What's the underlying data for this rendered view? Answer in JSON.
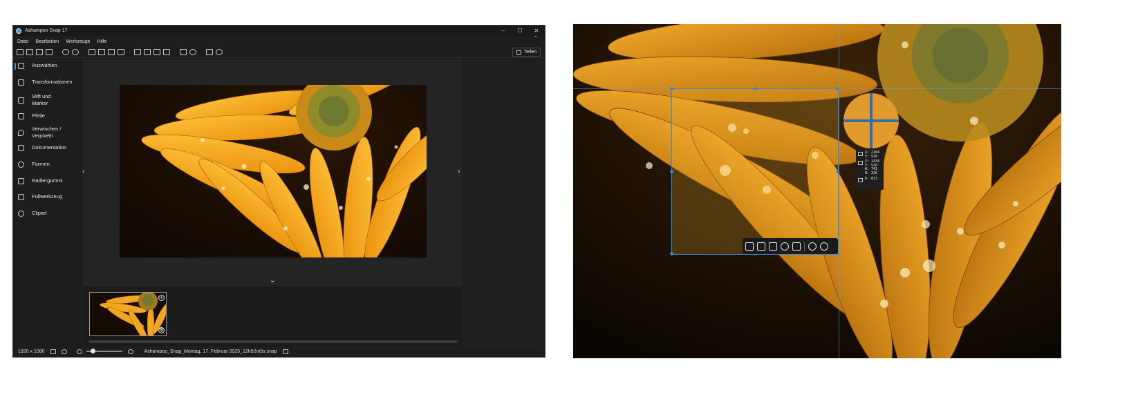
{
  "app": {
    "title": "Ashampoo Snap 17",
    "window_controls": [
      "–",
      "☐",
      "✕"
    ],
    "collapse_caret": "⌃"
  },
  "menu": [
    "Datei",
    "Bearbeiten",
    "Werkzeuge",
    "Hilfe"
  ],
  "toolbar": {
    "groups": [
      [
        "new-icon",
        "open-icon",
        "save-as-icon",
        "save-icon"
      ],
      [
        "undo-icon",
        "redo-icon"
      ],
      [
        "crop-icon",
        "copy-icon",
        "paste-icon",
        "delete-icon"
      ],
      [
        "clipboard-icon",
        "cloud-upload-icon",
        "email-icon",
        "print-icon"
      ],
      [
        "comment-icon",
        "help-icon"
      ],
      [
        "folder-icon",
        "settings-icon"
      ]
    ],
    "share_label": "Teilen"
  },
  "sidebar": {
    "items": [
      {
        "label": "Auswählen",
        "icon": "select-cursor-icon",
        "active": true
      },
      {
        "label": "Transformationen",
        "icon": "transform-icon"
      },
      {
        "label": "Stift und Marker",
        "icon": "pen-icon"
      },
      {
        "label": "Pfeile",
        "icon": "arrow-icon"
      },
      {
        "label": "Verwischen / Verpixeln",
        "icon": "blur-drop-icon"
      },
      {
        "label": "Dokumentation",
        "icon": "documentation-icon"
      },
      {
        "label": "Formen",
        "icon": "shapes-icon"
      },
      {
        "label": "Radiergummi",
        "icon": "eraser-icon"
      },
      {
        "label": "Füllwerkzeug",
        "icon": "fill-bucket-icon"
      },
      {
        "label": "Clipart",
        "icon": "clipart-smiley-icon"
      }
    ]
  },
  "canvas": {
    "nav_prev": "‹",
    "nav_next": "›",
    "collapse_strip": "⌄"
  },
  "filmstrip": {
    "badge_add": "+",
    "badge_settings": "⚙"
  },
  "status": {
    "dimensions": "1920 x 1080",
    "zoom_level": 0.15,
    "filename": "Ashampoo_Snap_Montag, 17. Februar 2025_12h52m5s.snap"
  },
  "capture_info": {
    "cursor": {
      "x": "X: 2164",
      "y": "Y: 528"
    },
    "region": {
      "x": "X: 1434",
      "y": "Y: 528",
      "w": "W: 741",
      "h": "H: 335"
    },
    "diagonal": "D: 813"
  },
  "capture_actions": [
    "camera-icon",
    "download-icon",
    "document-icon",
    "timer-icon",
    "video-capture-icon",
    "help-icon",
    "more-icon"
  ]
}
